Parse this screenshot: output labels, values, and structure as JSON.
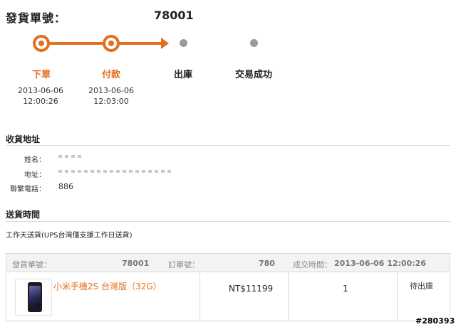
{
  "header": {
    "order_label": "發貨單號：",
    "order_no": "78001"
  },
  "progress": {
    "steps": [
      {
        "label": "下單",
        "date": "2013-06-06",
        "time": "12:00:26",
        "state": "done"
      },
      {
        "label": "付款",
        "date": "2013-06-06",
        "time": "12:03:00",
        "state": "done"
      },
      {
        "label": "出庫",
        "state": "pending"
      },
      {
        "label": "交易成功",
        "state": "pending"
      }
    ],
    "accent_color": "#e36f1e",
    "pending_color": "#9a9a9a"
  },
  "shipping_address": {
    "title": "收貨地址",
    "name_label": "姓名：",
    "address_label": "地址：",
    "phone_label": "聯繫電話：",
    "phone_value": "886"
  },
  "delivery": {
    "title": "送貨時間",
    "text": "工作天送貨(UPS台灣僅支援工作日送貨)"
  },
  "order_table": {
    "ship_no_label": "發貨單號：",
    "ship_no": "78001",
    "order_no_label": "訂單號：",
    "order_no": "780",
    "deal_time_label": "成交時間：",
    "deal_time": "2013-06-06 12:00:26",
    "item": {
      "name": "小米手機2S 台灣版（32G）",
      "price": "NT$11199",
      "qty": "1",
      "status": "待出庫",
      "icon": "phone-image"
    }
  },
  "watermark": "#280393"
}
